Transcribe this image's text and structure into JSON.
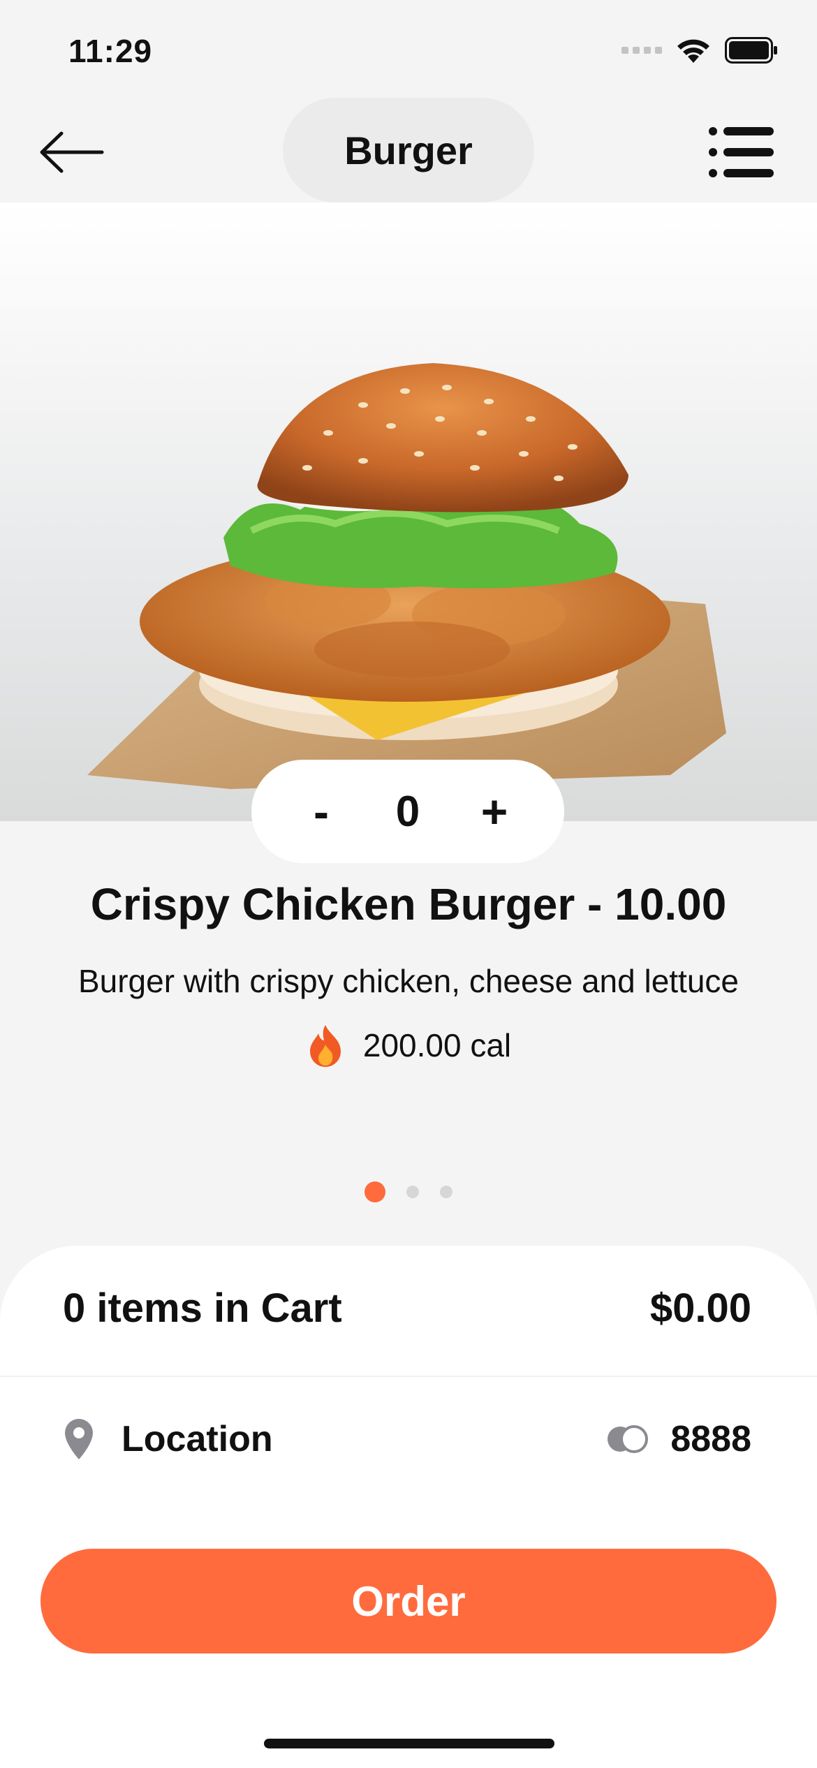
{
  "status_bar": {
    "time": "11:29"
  },
  "nav": {
    "title": "Burger",
    "back_icon": "arrow-left-icon",
    "menu_icon": "list-menu-icon"
  },
  "product": {
    "image_alt": "crispy chicken burger photo",
    "quantity": "0",
    "decrement_label": "-",
    "increment_label": "+",
    "title": "Crispy Chicken Burger - 10.00",
    "description": "Burger with crispy chicken, cheese and lettuce",
    "calories": "200.00 cal",
    "calorie_icon": "fire-icon"
  },
  "pager": {
    "count": 3,
    "active_index": 0
  },
  "cart": {
    "summary": "0 items in Cart",
    "total": "$0.00"
  },
  "location": {
    "label": "Location",
    "icon": "location-pin-icon",
    "coins_icon": "coins-icon",
    "points": "8888"
  },
  "order_button": {
    "label": "Order"
  },
  "colors": {
    "accent": "#ff6b3d",
    "background": "#f4f4f4",
    "sheet": "#ffffff"
  }
}
